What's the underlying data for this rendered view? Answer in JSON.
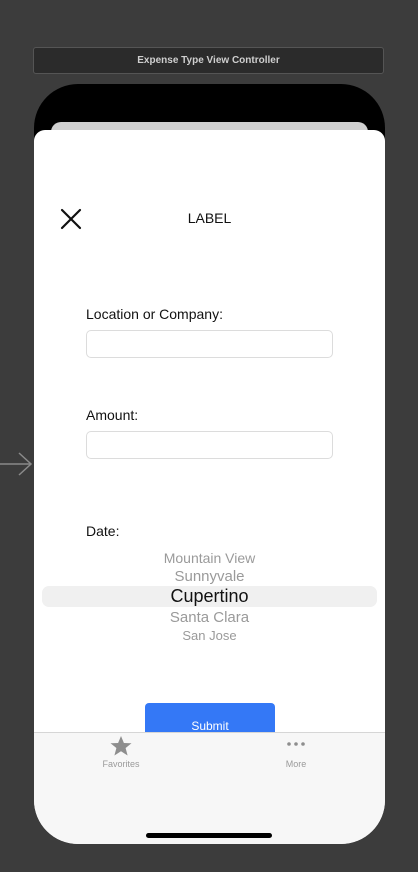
{
  "scene": {
    "title": "Expense Type View Controller"
  },
  "nav": {
    "close_icon": "close-icon",
    "title": "LABEL"
  },
  "form": {
    "location_label": "Location or Company:",
    "location_value": "",
    "amount_label": "Amount:",
    "amount_value": "",
    "date_label": "Date:"
  },
  "picker": {
    "options": [
      "Mountain View",
      "Sunnyvale",
      "Cupertino",
      "Santa Clara",
      "San Jose"
    ],
    "selected": "Cupertino"
  },
  "submit": {
    "label": "Submit",
    "color": "#3478f6"
  },
  "tabbar": {
    "items": [
      {
        "label": "Favorites",
        "icon": "star-icon"
      },
      {
        "label": "More",
        "icon": "more-icon"
      }
    ]
  }
}
